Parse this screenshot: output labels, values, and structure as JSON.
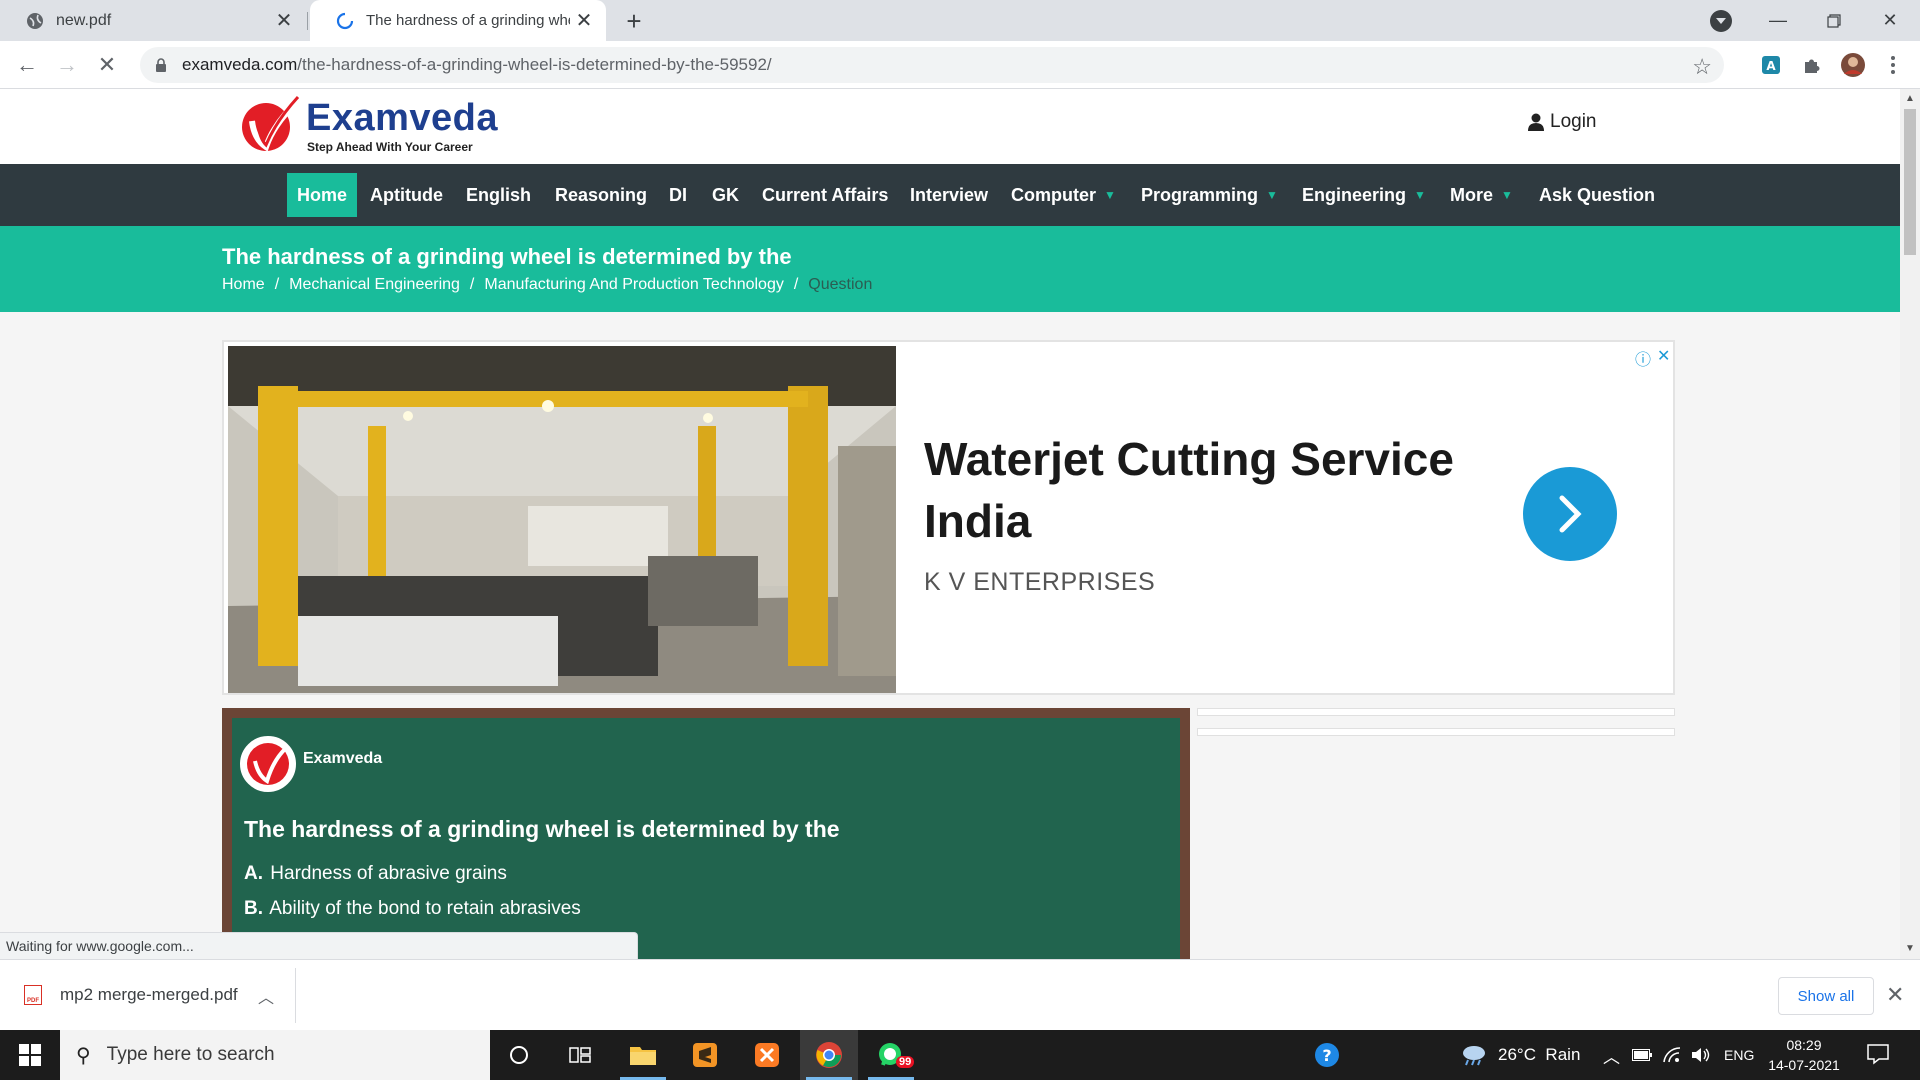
{
  "browser": {
    "tabs": [
      {
        "title": "new.pdf",
        "active": false
      },
      {
        "title": "The hardness of a grinding wheel is determined by the",
        "active": true
      }
    ],
    "url_host": "examveda.com",
    "url_path": "/the-hardness-of-a-grinding-wheel-is-determined-by-the-59592/",
    "status_text": "Waiting for www.google.com..."
  },
  "site": {
    "brand": "Examveda",
    "tagline": "Step Ahead With Your Career",
    "login_label": "Login",
    "nav": [
      {
        "label": "Home",
        "dropdown": false,
        "active": true
      },
      {
        "label": "Aptitude",
        "dropdown": false
      },
      {
        "label": "English",
        "dropdown": false
      },
      {
        "label": "Reasoning",
        "dropdown": false
      },
      {
        "label": "DI",
        "dropdown": false
      },
      {
        "label": "GK",
        "dropdown": false
      },
      {
        "label": "Current Affairs",
        "dropdown": false
      },
      {
        "label": "Interview",
        "dropdown": false
      },
      {
        "label": "Computer",
        "dropdown": true
      },
      {
        "label": "Programming",
        "dropdown": true
      },
      {
        "label": "Engineering",
        "dropdown": true
      },
      {
        "label": "More",
        "dropdown": true
      },
      {
        "label": "Ask Question",
        "dropdown": false
      }
    ],
    "page_title": "The hardness of a grinding wheel is determined by the",
    "breadcrumbs": [
      "Home",
      "Mechanical Engineering",
      "Manufacturing And Production Technology",
      "Question"
    ],
    "breadcrumb_sep": "/"
  },
  "ad": {
    "title": "Waterjet Cutting Service India",
    "advertiser": "K V ENTERPRISES"
  },
  "question": {
    "author": "Examveda",
    "text": "The hardness of a grinding wheel is determined by the",
    "options": [
      {
        "letter": "A.",
        "text": "Hardness of abrasive grains"
      },
      {
        "letter": "B.",
        "text": "Ability of the bond to retain abrasives"
      }
    ]
  },
  "downloads": {
    "file": "mp2 merge-merged.pdf",
    "show_all": "Show all"
  },
  "taskbar": {
    "search_placeholder": "Type here to search",
    "weather": "26°C  Rain",
    "language": "ENG",
    "time": "08:29",
    "date": "14-07-2021",
    "whatsapp_badge": "99"
  },
  "colors": {
    "accent": "#19bc9b",
    "nav_bg": "#2f3a40",
    "board_green": "#21644e",
    "board_frame": "#6b4536",
    "ad_button": "#1a9ad6"
  }
}
